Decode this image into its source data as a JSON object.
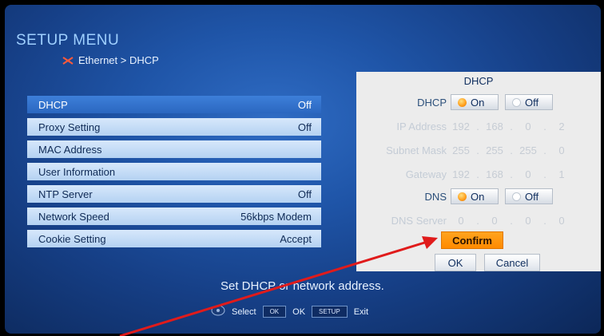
{
  "header": {
    "title": "SETUP MENU",
    "breadcrumb": "Ethernet > DHCP"
  },
  "settings": [
    {
      "label": "DHCP",
      "value": "Off"
    },
    {
      "label": "Proxy Setting",
      "value": "Off"
    },
    {
      "label": "MAC Address",
      "value": ""
    },
    {
      "label": "User Information",
      "value": ""
    },
    {
      "label": "NTP Server",
      "value": "Off"
    },
    {
      "label": "Network Speed",
      "value": "56kbps Modem"
    },
    {
      "label": "Cookie Setting",
      "value": "Accept"
    }
  ],
  "panel": {
    "title": "DHCP",
    "dhcp_label": "DHCP",
    "dns_label": "DNS",
    "on_label": "On",
    "off_label": "Off",
    "ip_label": "IP Address",
    "subnet_label": "Subnet Mask",
    "gateway_label": "Gateway",
    "dns_server_label": "DNS Server",
    "ip": [
      "192",
      "168",
      "0",
      "2"
    ],
    "subnet": [
      "255",
      "255",
      "255",
      "0"
    ],
    "gateway": [
      "192",
      "168",
      "0",
      "1"
    ],
    "dns_server": [
      "0",
      "0",
      "0",
      "0"
    ],
    "confirm_label": "Confirm",
    "ok_label": "OK",
    "cancel_label": "Cancel"
  },
  "footer": {
    "help": "Set DHCP or network address.",
    "select_label": "Select",
    "ok_key": "OK",
    "ok_label": "OK",
    "setup_key": "SETUP",
    "exit_label": "Exit"
  },
  "colors": {
    "accent": "#ff8a00",
    "selected_row": "#2b67c0",
    "arrow": "#e01b1b"
  }
}
